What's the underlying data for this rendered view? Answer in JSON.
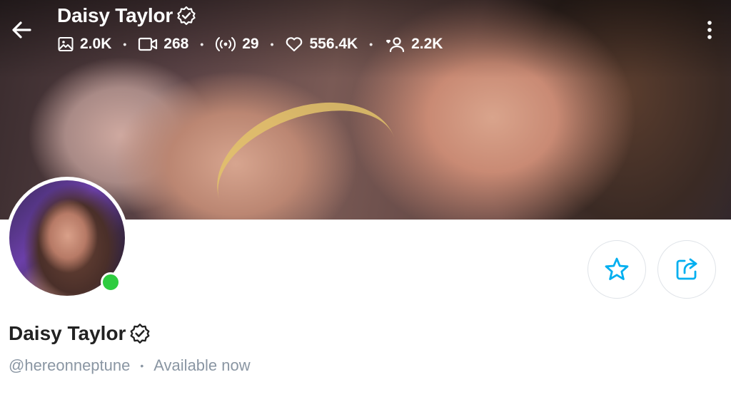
{
  "header": {
    "name": "Daisy Taylor",
    "stats": [
      {
        "icon": "image-icon",
        "value": "2.0K"
      },
      {
        "icon": "video-icon",
        "value": "268"
      },
      {
        "icon": "stream-icon",
        "value": "29"
      },
      {
        "icon": "heart-icon",
        "value": "556.4K"
      },
      {
        "icon": "fans-icon",
        "value": "2.2K"
      }
    ]
  },
  "profile": {
    "name": "Daisy Taylor",
    "handle": "@hereonneptune",
    "status": "Available now",
    "online": true
  },
  "colors": {
    "accent": "#00aff0",
    "online": "#2ecc40",
    "muted_text": "#8a96a3"
  }
}
